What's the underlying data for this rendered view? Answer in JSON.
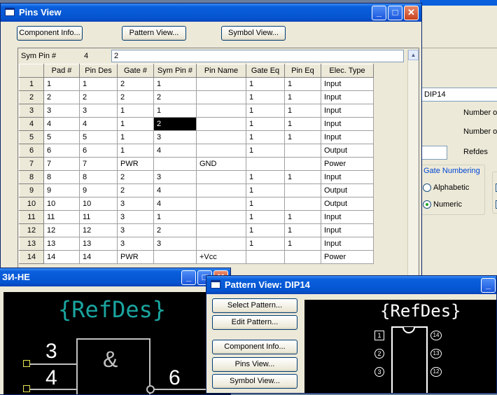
{
  "pins_view": {
    "title": "Pins View",
    "buttons": {
      "component_info": "Component Info...",
      "pattern_view": "Pattern View...",
      "symbol_view": "Symbol View..."
    },
    "edit_bar": {
      "label": "Sym Pin #",
      "row": "4",
      "value": "2"
    },
    "columns": [
      "Pad #",
      "Pin Des",
      "Gate #",
      "Sym Pin #",
      "Pin Name",
      "Gate Eq",
      "Pin Eq",
      "Elec. Type"
    ],
    "rows": [
      [
        "1",
        "1",
        "1",
        "2",
        "1",
        "",
        "1",
        "1",
        "Input"
      ],
      [
        "2",
        "2",
        "2",
        "2",
        "2",
        "",
        "1",
        "1",
        "Input"
      ],
      [
        "3",
        "3",
        "3",
        "1",
        "1",
        "",
        "1",
        "1",
        "Input"
      ],
      [
        "4",
        "4",
        "4",
        "1",
        "2",
        "",
        "1",
        "1",
        "Input"
      ],
      [
        "5",
        "5",
        "5",
        "1",
        "3",
        "",
        "1",
        "1",
        "Input"
      ],
      [
        "6",
        "6",
        "6",
        "1",
        "4",
        "",
        "1",
        "",
        "Output"
      ],
      [
        "7",
        "7",
        "7",
        "PWR",
        "",
        "GND",
        "",
        "",
        "Power"
      ],
      [
        "8",
        "8",
        "8",
        "2",
        "3",
        "",
        "1",
        "1",
        "Input"
      ],
      [
        "9",
        "9",
        "9",
        "2",
        "4",
        "",
        "1",
        "",
        "Output"
      ],
      [
        "10",
        "10",
        "10",
        "3",
        "4",
        "",
        "1",
        "",
        "Output"
      ],
      [
        "11",
        "11",
        "11",
        "3",
        "1",
        "",
        "1",
        "1",
        "Input"
      ],
      [
        "12",
        "12",
        "12",
        "3",
        "2",
        "",
        "1",
        "1",
        "Input"
      ],
      [
        "13",
        "13",
        "13",
        "3",
        "3",
        "",
        "1",
        "1",
        "Input"
      ],
      [
        "14",
        "14",
        "14",
        "PWR",
        "",
        "+Vcc",
        "",
        "",
        "Power"
      ]
    ]
  },
  "component_panel": {
    "pattern_name": "DIP14",
    "number_of_1": "Number of",
    "number_of_2": "Number of",
    "refdes_label": "Refdes",
    "gate_numbering": "Gate Numbering",
    "alphabetic": "Alphabetic",
    "numeric": "Numeric"
  },
  "symbol_window": {
    "title": "ЗИ-НЕ",
    "refdes": "{RefDes}",
    "gate_symbol": "&",
    "pins": [
      "3",
      "4",
      "6"
    ]
  },
  "pattern_window": {
    "title": "Pattern View: DIP14",
    "buttons": [
      "Select Pattern...",
      "Edit Pattern...",
      "Component Info...",
      "Pins View...",
      "Symbol View..."
    ],
    "refdes": "{RefDes}",
    "left_pads": [
      "1",
      "2",
      "3"
    ],
    "right_pads": [
      "14",
      "13",
      "12"
    ]
  }
}
